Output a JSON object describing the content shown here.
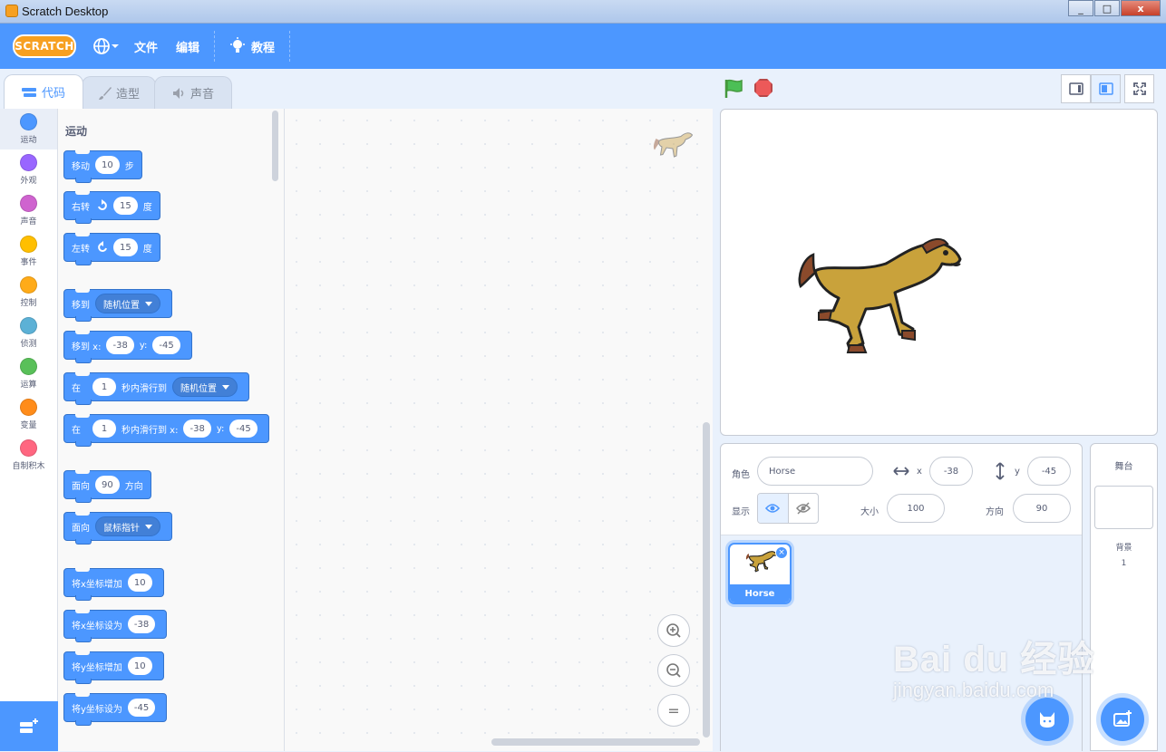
{
  "window": {
    "title": "Scratch Desktop"
  },
  "menubar": {
    "logo": "SCRATCH",
    "file": "文件",
    "edit": "编辑",
    "tutorials": "教程"
  },
  "tabs": {
    "code": "代码",
    "costumes": "造型",
    "sounds": "声音"
  },
  "categories": [
    {
      "label": "运动",
      "color": "#4c97ff"
    },
    {
      "label": "外观",
      "color": "#9966ff"
    },
    {
      "label": "声音",
      "color": "#cf63cf"
    },
    {
      "label": "事件",
      "color": "#ffbf00"
    },
    {
      "label": "控制",
      "color": "#ffab19"
    },
    {
      "label": "侦测",
      "color": "#5cb1d6"
    },
    {
      "label": "运算",
      "color": "#59c059"
    },
    {
      "label": "变量",
      "color": "#ff8c1a"
    },
    {
      "label": "自制积木",
      "color": "#ff6680"
    }
  ],
  "palette": {
    "section_title": "运动",
    "move": {
      "a": "移动",
      "v": "10",
      "b": "步"
    },
    "turn_right": {
      "a": "右转",
      "v": "15",
      "b": "度"
    },
    "turn_left": {
      "a": "左转",
      "v": "15",
      "b": "度"
    },
    "goto": {
      "a": "移到",
      "dd": "随机位置"
    },
    "goto_xy": {
      "a": "移到 x:",
      "x": "-38",
      "b": "y:",
      "y": "-45"
    },
    "glide": {
      "a": "在",
      "v": "1",
      "b": "秒内滑行到",
      "dd": "随机位置"
    },
    "glide_xy": {
      "a": "在",
      "v": "1",
      "b": "秒内滑行到 x:",
      "x": "-38",
      "c": "y:",
      "y": "-45"
    },
    "point_dir": {
      "a": "面向",
      "v": "90",
      "b": "方向"
    },
    "point_towards": {
      "a": "面向",
      "dd": "鼠标指针"
    },
    "change_x": {
      "a": "将x坐标增加",
      "v": "10"
    },
    "set_x": {
      "a": "将x坐标设为",
      "v": "-38"
    },
    "change_y": {
      "a": "将y坐标增加",
      "v": "10"
    },
    "set_y": {
      "a": "将y坐标设为",
      "v": "-45"
    }
  },
  "zoom": {
    "in": "+",
    "out": "−",
    "reset": "="
  },
  "sprite_info": {
    "sprite_label": "角色",
    "sprite_name": "Horse",
    "x_label": "x",
    "x": "-38",
    "y_label": "y",
    "y": "-45",
    "show_label": "显示",
    "size_label": "大小",
    "size": "100",
    "direction_label": "方向",
    "direction": "90"
  },
  "sprites": [
    {
      "name": "Horse",
      "delete": "×"
    }
  ],
  "stage_panel": {
    "title": "舞台",
    "backdrops_label": "背景",
    "backdrops_count": "1"
  },
  "watermark": {
    "logo": "Bai du 经验",
    "url": "jingyan.baidu.com"
  }
}
